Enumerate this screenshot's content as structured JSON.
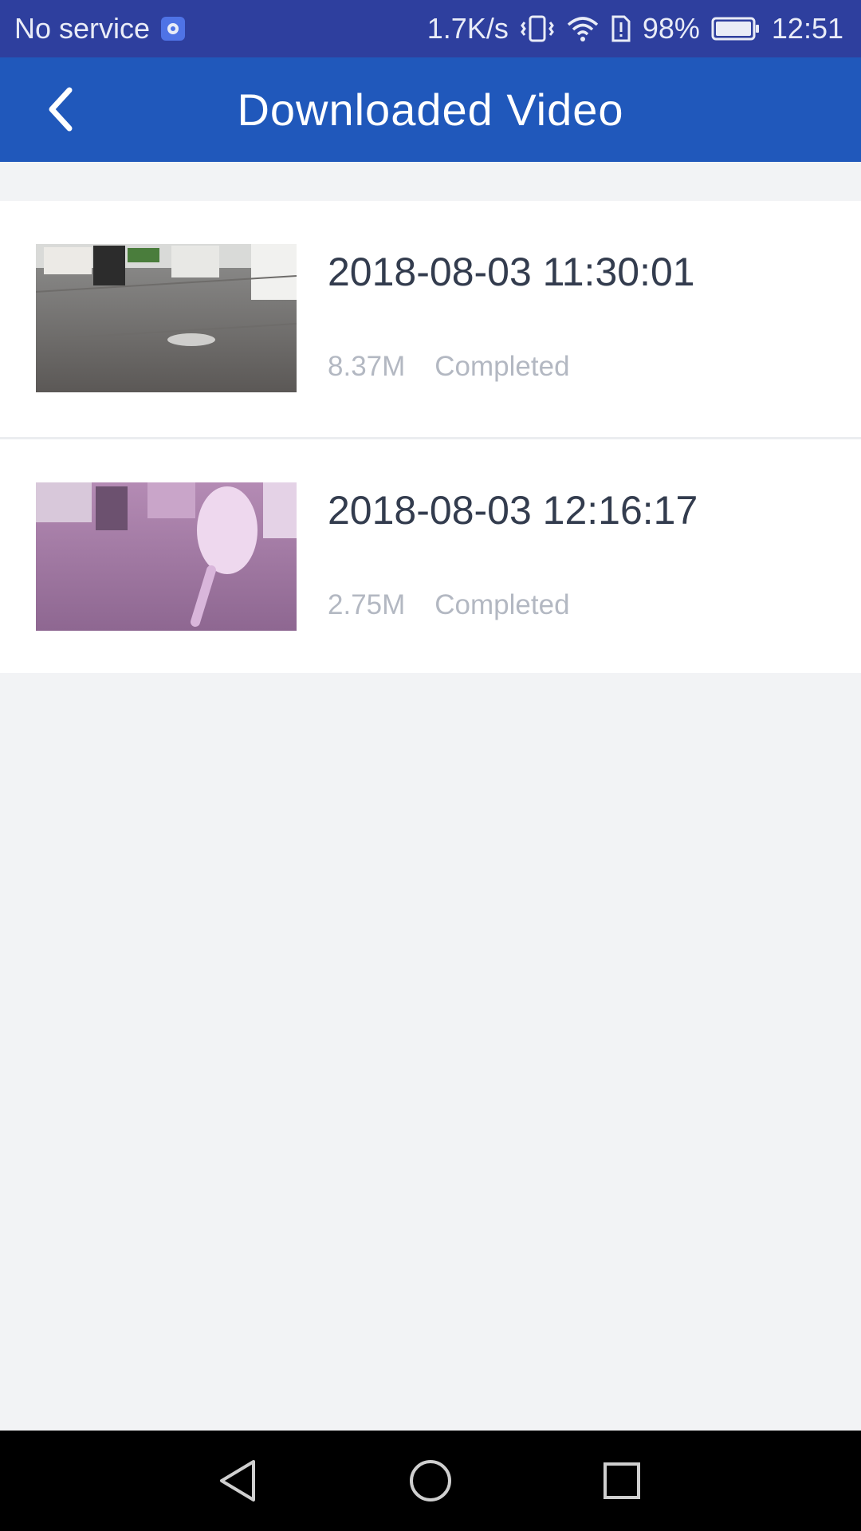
{
  "status_bar": {
    "carrier": "No service",
    "speed": "1.7K/s",
    "battery": "98%",
    "time": "12:51"
  },
  "app_bar": {
    "title": "Downloaded Video",
    "back_icon": "chevron-left-icon"
  },
  "videos": [
    {
      "datetime": "2018-08-03 11:30:01",
      "size": "8.37M",
      "status": "Completed"
    },
    {
      "datetime": "2018-08-03 12:16:17",
      "size": "2.75M",
      "status": "Completed"
    }
  ],
  "nav_bar": {
    "back": "triangle-back-icon",
    "home": "circle-home-icon",
    "recents": "square-recents-icon"
  },
  "colors": {
    "status_bar": "#2e3f9e",
    "app_bar": "#2058bb",
    "background": "#f2f3f5",
    "title_text": "#333c4e",
    "meta_text": "#b3b8c2"
  }
}
